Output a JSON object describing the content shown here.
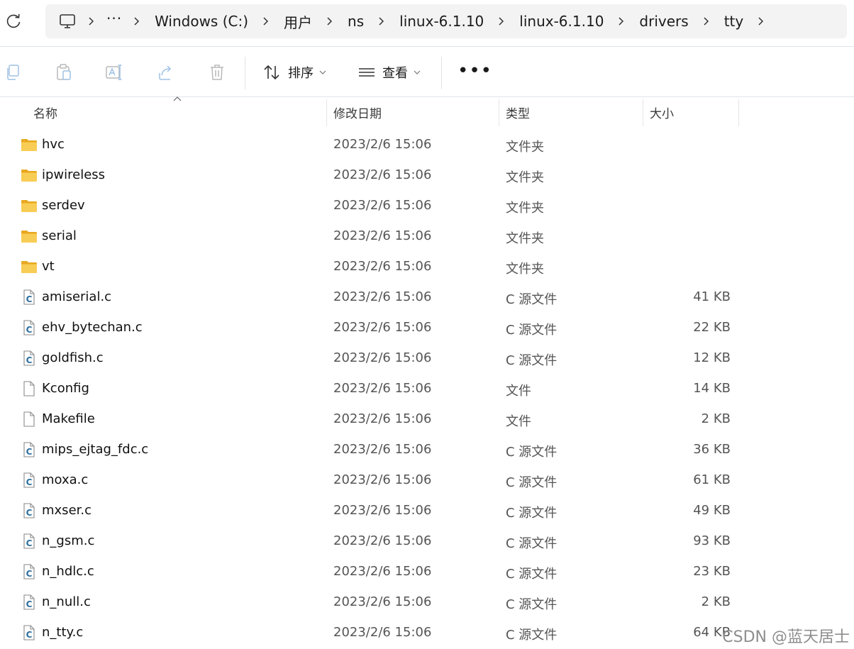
{
  "breadcrumb": {
    "items": [
      "Windows (C:)",
      "用户",
      "ns",
      "linux-6.1.10",
      "linux-6.1.10",
      "drivers",
      "tty"
    ],
    "overflow": "···"
  },
  "toolbar": {
    "sort_label": "排序",
    "view_label": "查看",
    "more_label": "•••"
  },
  "columns": {
    "name": "名称",
    "date": "修改日期",
    "type": "类型",
    "size": "大小"
  },
  "files": [
    {
      "name": "hvc",
      "date": "2023/2/6 15:06",
      "type": "文件夹",
      "size": "",
      "icon": "folder-icon"
    },
    {
      "name": "ipwireless",
      "date": "2023/2/6 15:06",
      "type": "文件夹",
      "size": "",
      "icon": "folder-icon"
    },
    {
      "name": "serdev",
      "date": "2023/2/6 15:06",
      "type": "文件夹",
      "size": "",
      "icon": "folder-icon"
    },
    {
      "name": "serial",
      "date": "2023/2/6 15:06",
      "type": "文件夹",
      "size": "",
      "icon": "folder-icon"
    },
    {
      "name": "vt",
      "date": "2023/2/6 15:06",
      "type": "文件夹",
      "size": "",
      "icon": "folder-icon"
    },
    {
      "name": "amiserial.c",
      "date": "2023/2/6 15:06",
      "type": "C 源文件",
      "size": "41 KB",
      "icon": "c-file-icon"
    },
    {
      "name": "ehv_bytechan.c",
      "date": "2023/2/6 15:06",
      "type": "C 源文件",
      "size": "22 KB",
      "icon": "c-file-icon"
    },
    {
      "name": "goldfish.c",
      "date": "2023/2/6 15:06",
      "type": "C 源文件",
      "size": "12 KB",
      "icon": "c-file-icon"
    },
    {
      "name": "Kconfig",
      "date": "2023/2/6 15:06",
      "type": "文件",
      "size": "14 KB",
      "icon": "file-icon"
    },
    {
      "name": "Makefile",
      "date": "2023/2/6 15:06",
      "type": "文件",
      "size": "2 KB",
      "icon": "file-icon"
    },
    {
      "name": "mips_ejtag_fdc.c",
      "date": "2023/2/6 15:06",
      "type": "C 源文件",
      "size": "36 KB",
      "icon": "c-file-icon"
    },
    {
      "name": "moxa.c",
      "date": "2023/2/6 15:06",
      "type": "C 源文件",
      "size": "61 KB",
      "icon": "c-file-icon"
    },
    {
      "name": "mxser.c",
      "date": "2023/2/6 15:06",
      "type": "C 源文件",
      "size": "49 KB",
      "icon": "c-file-icon"
    },
    {
      "name": "n_gsm.c",
      "date": "2023/2/6 15:06",
      "type": "C 源文件",
      "size": "93 KB",
      "icon": "c-file-icon"
    },
    {
      "name": "n_hdlc.c",
      "date": "2023/2/6 15:06",
      "type": "C 源文件",
      "size": "23 KB",
      "icon": "c-file-icon"
    },
    {
      "name": "n_null.c",
      "date": "2023/2/6 15:06",
      "type": "C 源文件",
      "size": "2 KB",
      "icon": "c-file-icon"
    },
    {
      "name": "n_tty.c",
      "date": "2023/2/6 15:06",
      "type": "C 源文件",
      "size": "64 KB",
      "icon": "c-file-icon"
    }
  ],
  "watermark": "CSDN @蓝天居士",
  "colors": {
    "folder": "#f5c542",
    "c_file_letter": "#2c6e9e",
    "address_bg": "#f3f3f3"
  }
}
